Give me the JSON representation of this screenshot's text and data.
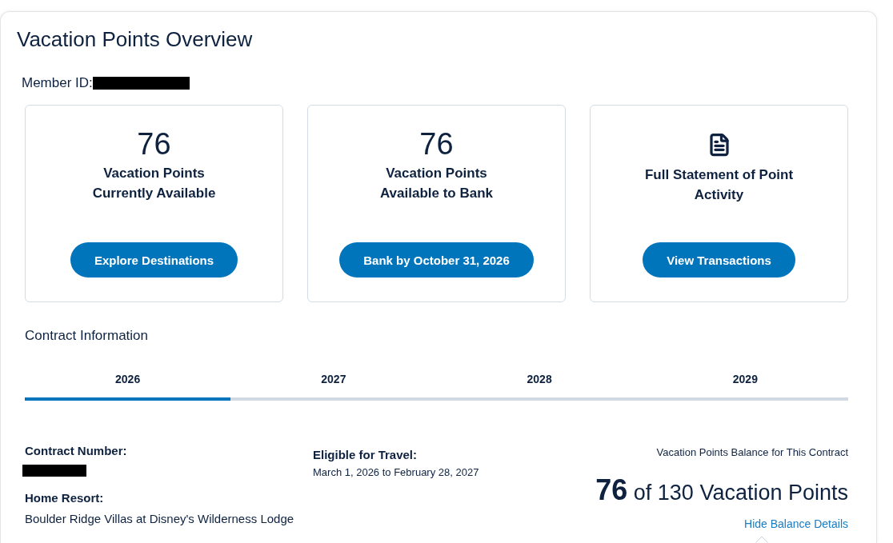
{
  "page": {
    "title": "Vacation Points Overview"
  },
  "member_id": {
    "label": "Member ID:",
    "redacted": true
  },
  "summary_cards": [
    {
      "kind": "count",
      "value": "76",
      "label": "Vacation Points Currently Available",
      "button": "Explore Destinations"
    },
    {
      "kind": "count",
      "value": "76",
      "label": "Vacation Points Available to Bank",
      "button": "Bank by October 31, 2026"
    },
    {
      "kind": "statement",
      "label": "Full Statement of Point Activity",
      "button": "View Transactions"
    }
  ],
  "contract_information": {
    "heading": "Contract Information",
    "tabs": [
      {
        "label": "2026",
        "selected": true
      },
      {
        "label": "2027",
        "selected": false
      },
      {
        "label": "2028",
        "selected": false
      },
      {
        "label": "2029",
        "selected": false
      }
    ]
  },
  "contract_details": {
    "contract_number": {
      "label": "Contract Number:",
      "redacted": true
    },
    "home_resort": {
      "label": "Home Resort:",
      "value": "Boulder Ridge Villas at Disney's Wilderness Lodge"
    },
    "eligible_for_travel": {
      "label": "Eligible for Travel:",
      "value": "March 1, 2026 to February 28, 2027"
    },
    "balance": {
      "caption": "Vacation Points Balance for This Contract",
      "summary": "**76** of 130 Vacation Points",
      "toggle_link": "Hide Balance Details",
      "expanded": true
    }
  }
}
